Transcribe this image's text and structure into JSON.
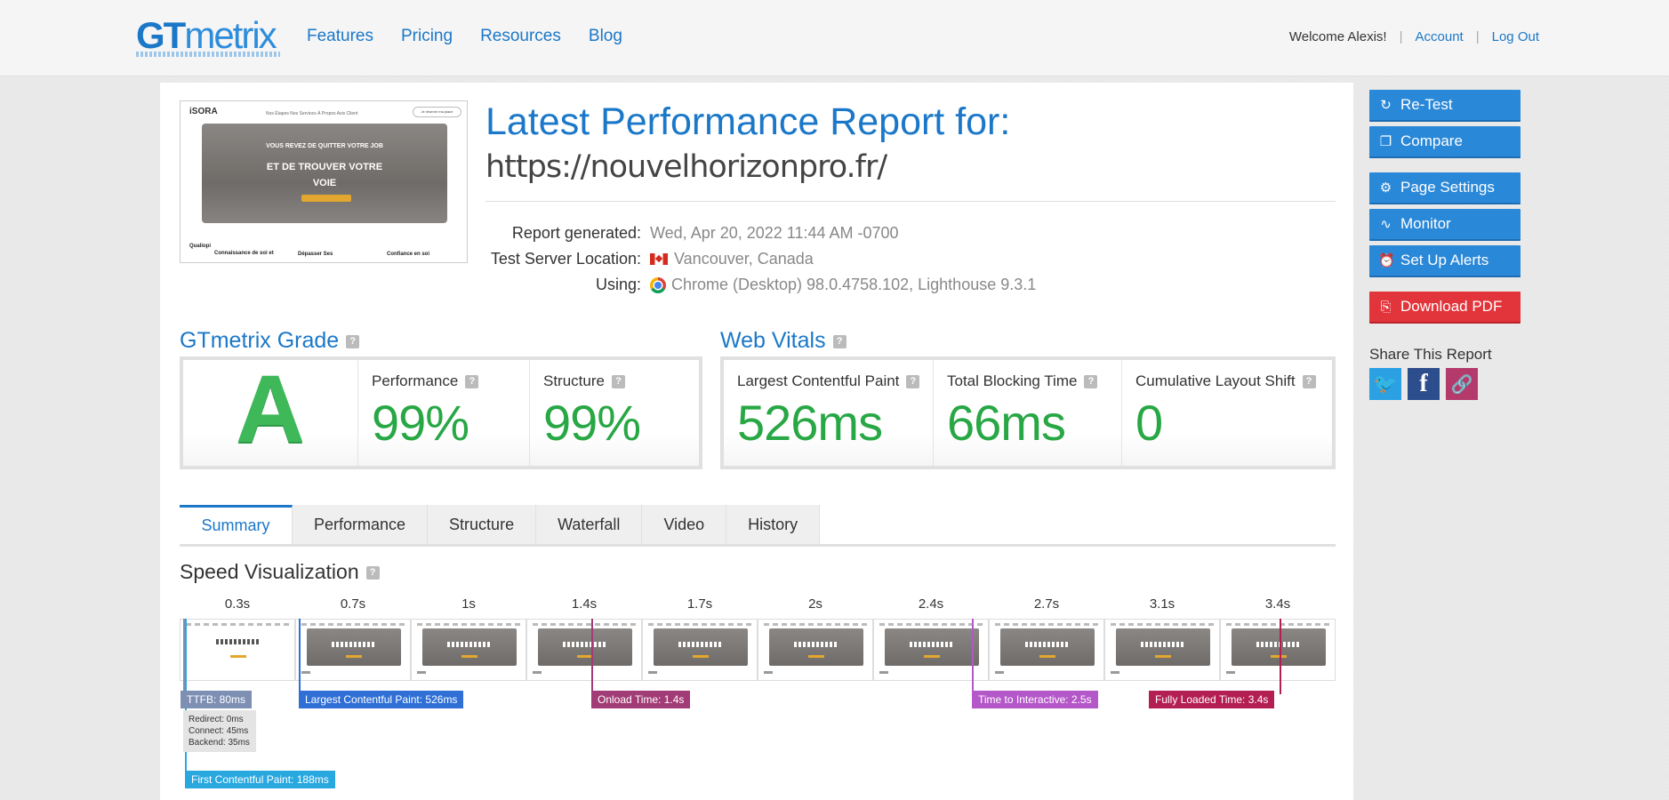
{
  "header": {
    "logo_gt": "GT",
    "logo_metrix": "metrix",
    "nav": [
      "Features",
      "Pricing",
      "Resources",
      "Blog"
    ],
    "welcome": "Welcome Alexis!",
    "account": "Account",
    "logout": "Log Out"
  },
  "report": {
    "title": "Latest Performance Report for:",
    "url": "https://nouvelhorizonpro.fr/",
    "generated_label": "Report generated:",
    "generated_value": "Wed, Apr 20, 2022 11:44 AM -0700",
    "location_label": "Test Server Location:",
    "location_value": "Vancouver, Canada",
    "using_label": "Using:",
    "using_value": "Chrome (Desktop) 98.0.4758.102, Lighthouse 9.3.1"
  },
  "thumbnail": {
    "logo": "iSORA",
    "links": "Nos Étapes   Nos Services   À Propos   Avis Client",
    "button": "Je réserve ma place",
    "hero_line1": "VOUS REVEZ DE QUITTER VOTRE JOB",
    "hero_line2": "ET DE TROUVER VOTRE",
    "hero_line3": "VOIE",
    "foot1": "Qualiopi",
    "foot2": "Connaissance de soi et",
    "foot3": "Dépasser Ses",
    "foot4": "Confiance en soi"
  },
  "grade": {
    "title": "GTmetrix Grade",
    "letter": "A",
    "performance_label": "Performance",
    "performance_value": "99%",
    "structure_label": "Structure",
    "structure_value": "99%"
  },
  "vitals": {
    "title": "Web Vitals",
    "lcp_label": "Largest Contentful Paint",
    "lcp_value": "526ms",
    "tbt_label": "Total Blocking Time",
    "tbt_value": "66ms",
    "cls_label": "Cumulative Layout Shift",
    "cls_value": "0"
  },
  "tabs": [
    "Summary",
    "Performance",
    "Structure",
    "Waterfall",
    "Video",
    "History"
  ],
  "active_tab": "Summary",
  "speed": {
    "title": "Speed Visualization",
    "times": [
      "0.3s",
      "0.7s",
      "1s",
      "1.4s",
      "1.7s",
      "2s",
      "2.4s",
      "2.7s",
      "3.1s",
      "3.4s"
    ],
    "markers": {
      "ttfb": "TTFB: 80ms",
      "lcp": "Largest Contentful Paint: 526ms",
      "onload": "Onload Time: 1.4s",
      "tti": "Time to Interactive: 2.5s",
      "fully_loaded": "Fully Loaded Time: 3.4s",
      "fcp": "First Contentful Paint: 188ms"
    },
    "ttfb_detail": {
      "redirect": "Redirect: 0ms",
      "connect": "Connect: 45ms",
      "backend": "Backend: 35ms"
    }
  },
  "sidebar": {
    "retest": "Re-Test",
    "compare": "Compare",
    "page_settings": "Page Settings",
    "monitor": "Monitor",
    "alerts": "Set Up Alerts",
    "pdf": "Download PDF",
    "share_title": "Share This Report"
  },
  "colors": {
    "brand_blue": "#1b78c8",
    "grade_green": "#28a745",
    "pdf_red": "#e2353b"
  }
}
